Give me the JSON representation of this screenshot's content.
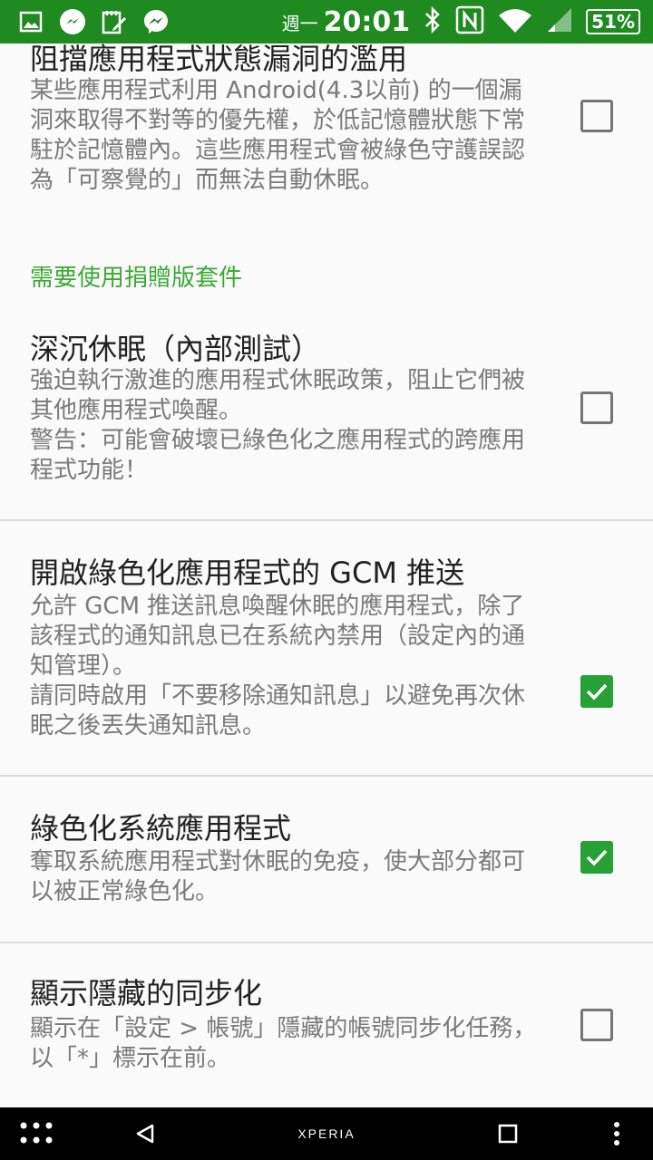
{
  "status_bar": {
    "week": "週一",
    "time": "20:01",
    "battery": "51%",
    "icons_left": [
      "gallery-icon",
      "messenger-lightning-icon",
      "notes-icon",
      "messenger-icon"
    ],
    "icons_right": [
      "bluetooth-icon",
      "nfc-icon",
      "wifi-icon",
      "signal-icon",
      "battery-icon"
    ]
  },
  "prefs": [
    {
      "title": "阻擋應用程式狀態漏洞的濫用",
      "summary": "某些應用程式利用 Android(4.3以前) 的一個漏洞來取得不對等的優先權，於低記憶體狀態下常駐於記憶體內。這些應用程式會被綠色守護誤認為「可察覺的」而無法自動休眠。",
      "checked": false
    },
    {
      "category": "需要使用捐贈版套件"
    },
    {
      "title": "深沉休眠（內部測試）",
      "summary": "強迫執行激進的應用程式休眠政策，阻止它們被其他應用程式喚醒。\n警告：可能會破壞已綠色化之應用程式的跨應用程式功能！",
      "checked": false
    },
    {
      "title": "開啟綠色化應用程式的 GCM 推送",
      "summary": "允許 GCM 推送訊息喚醒休眠的應用程式，除了該程式的通知訊息已在系統內禁用（設定內的通知管理）。\n請同時啟用「不要移除通知訊息」以避免再次休眠之後丟失通知訊息。",
      "checked": true
    },
    {
      "title": "綠色化系統應用程式",
      "summary": "奪取系統應用程式對休眠的免疫，使大部分都可以被正常綠色化。",
      "checked": true
    },
    {
      "title": "顯示隱藏的同步化",
      "summary": "顯示在「設定 > 帳號」隱藏的帳號同步化任務，以「*」標示在前。",
      "checked": false
    }
  ],
  "nav_bar": {
    "brand": "XPERIA",
    "icons": [
      "apps-grid-icon",
      "back-icon",
      "recents-icon",
      "overflow-menu-icon"
    ]
  },
  "colors": {
    "status_bar": "#1f8a1f",
    "accent": "#27a135",
    "category": "#3aa935"
  }
}
